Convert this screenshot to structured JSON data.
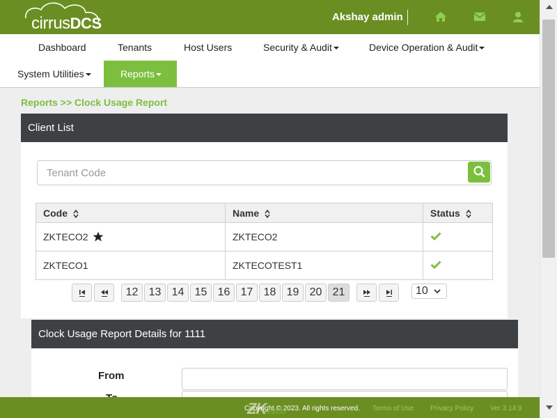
{
  "header": {
    "logo_main": "cirrus",
    "logo_bold": "DCS",
    "user_name": "Akshay admin",
    "icons": [
      "home-icon",
      "mail-icon",
      "user-icon"
    ]
  },
  "nav": {
    "dashboard": "Dashboard",
    "tenants": "Tenants",
    "host_users": "Host Users",
    "security_audit": "Security & Audit",
    "device_operation_audit": "Device Operation & Audit",
    "system_utilities": "System Utilities",
    "reports": "Reports"
  },
  "breadcrumb": "Reports >> Clock Usage Report",
  "client_list": {
    "title": "Client List",
    "search_placeholder": "Tenant Code",
    "columns": [
      "Code",
      "Name",
      "Status"
    ],
    "rows": [
      {
        "code": "ZKTECO2",
        "name": "ZKTECO2",
        "starred": true,
        "status": "active"
      },
      {
        "code": "ZKTECO1",
        "name": "ZKTECOTEST1",
        "starred": false,
        "status": "active"
      }
    ],
    "pages": [
      "12",
      "13",
      "14",
      "15",
      "16",
      "17",
      "18",
      "19",
      "20",
      "21"
    ],
    "current_page": "21",
    "page_size": "10"
  },
  "report_details": {
    "title": "Clock Usage Report Details for 1111",
    "from_label": "From",
    "to_label": "To"
  },
  "footer": {
    "copyright": "Copyright © 2023. All rights reserved.",
    "terms": "Terms of Use",
    "privacy": "Privacy Policy",
    "version": "Ver 3.14.9",
    "watermark_main": "ZK",
    "watermark_sub": "Teco"
  },
  "colors": {
    "brand_green": "#6b8e23",
    "accent_green": "#7cbf3f",
    "panel_header": "#3e4144"
  }
}
